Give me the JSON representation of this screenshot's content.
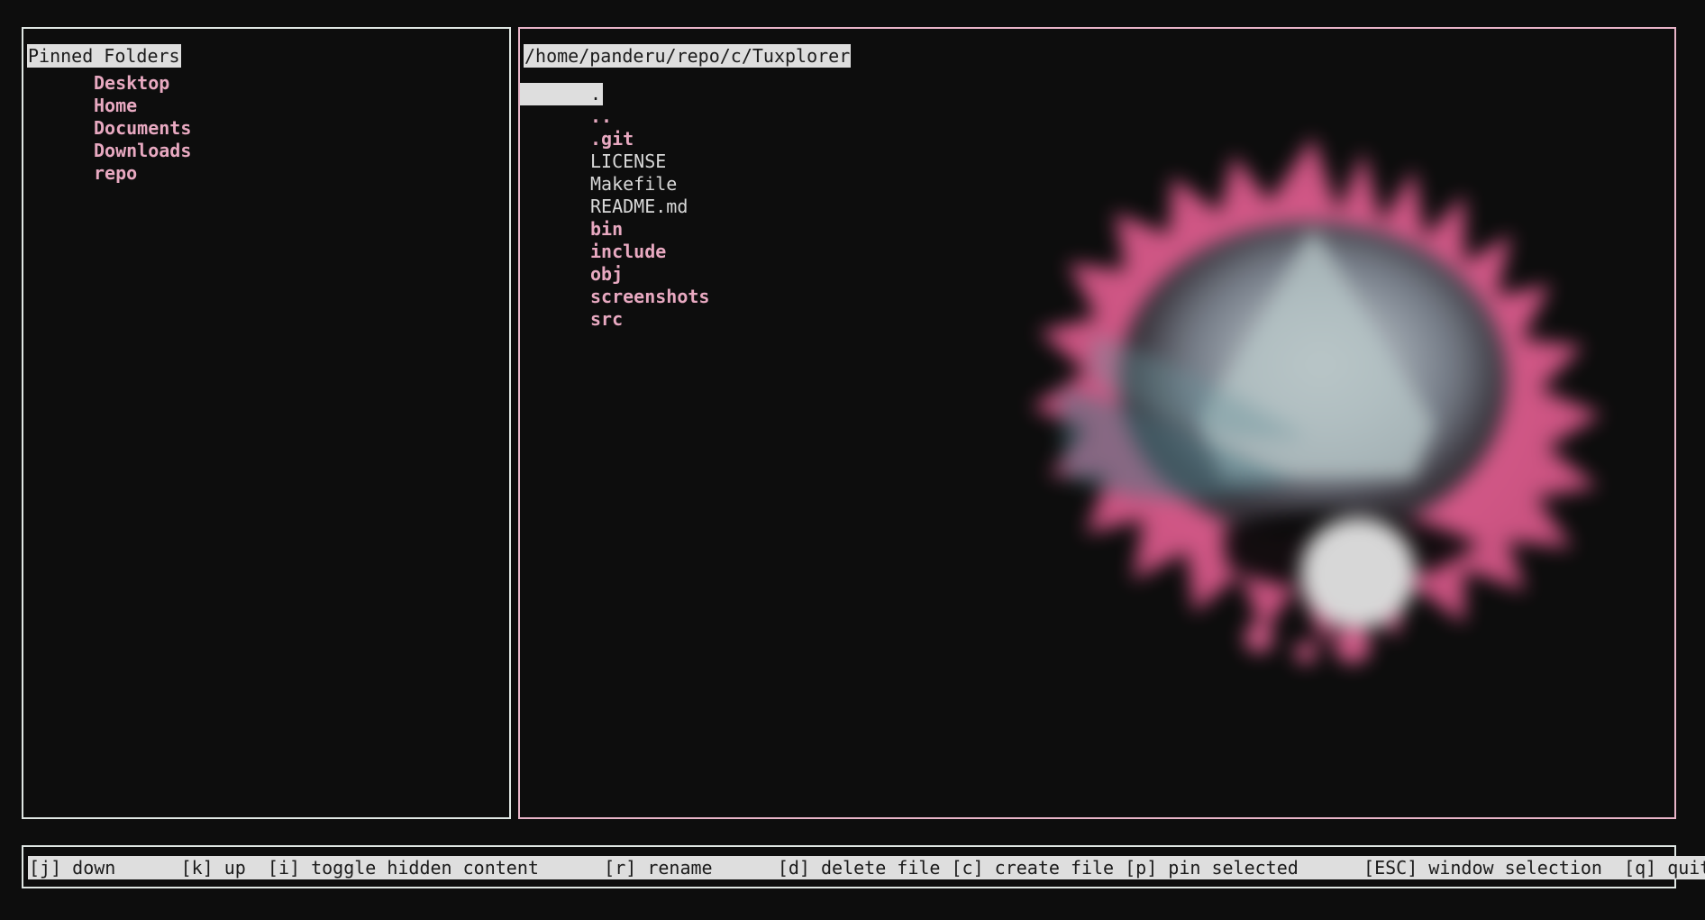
{
  "app": {
    "name": "Tuxplorer",
    "background": "#0d0d0d",
    "accent_pink": "#e8a9c1",
    "accent_white": "#dfe6e3",
    "highlight_bg": "#dedede",
    "highlight_fg": "#1b1b1b"
  },
  "pinned_pane": {
    "title": "Pinned Folders",
    "border_color": "#dfe6e3",
    "items": [
      {
        "label": "Desktop",
        "kind": "dir",
        "selected": false
      },
      {
        "label": "Home",
        "kind": "dir",
        "selected": false
      },
      {
        "label": "Documents",
        "kind": "dir",
        "selected": false
      },
      {
        "label": "Downloads",
        "kind": "dir",
        "selected": false
      },
      {
        "label": "repo",
        "kind": "dir",
        "selected": false
      }
    ]
  },
  "file_pane": {
    "path": "/home/panderu/repo/c/Tuxplorer",
    "border_color": "#e8b4c8",
    "entries": [
      {
        "label": ".",
        "kind": "dir",
        "selected": true
      },
      {
        "label": "..",
        "kind": "updir",
        "selected": false
      },
      {
        "label": ".git",
        "kind": "dir",
        "selected": false
      },
      {
        "label": "LICENSE",
        "kind": "file",
        "selected": false
      },
      {
        "label": "Makefile",
        "kind": "file",
        "selected": false
      },
      {
        "label": "README.md",
        "kind": "file",
        "selected": false
      },
      {
        "label": "bin",
        "kind": "dir",
        "selected": false
      },
      {
        "label": "include",
        "kind": "dir",
        "selected": false
      },
      {
        "label": "obj",
        "kind": "dir",
        "selected": false
      },
      {
        "label": "screenshots",
        "kind": "dir",
        "selected": false
      },
      {
        "label": "src",
        "kind": "dir",
        "selected": false
      }
    ],
    "preview": {
      "name": "image-preview",
      "description": "blurred pink starburst artwork preview"
    }
  },
  "status_bar": {
    "text": "[j] down      [k] up  [i] toggle hidden content      [r] rename      [d] delete file [c] create file [p] pin selected      [ESC] window selection  [q] quit",
    "keys": [
      {
        "key": "[j]",
        "action": "down"
      },
      {
        "key": "[k]",
        "action": "up"
      },
      {
        "key": "[i]",
        "action": "toggle hidden content"
      },
      {
        "key": "[r]",
        "action": "rename"
      },
      {
        "key": "[d]",
        "action": "delete file"
      },
      {
        "key": "[c]",
        "action": "create file"
      },
      {
        "key": "[p]",
        "action": "pin selected"
      },
      {
        "key": "[ESC]",
        "action": "window selection"
      },
      {
        "key": "[q]",
        "action": "quit"
      }
    ]
  }
}
